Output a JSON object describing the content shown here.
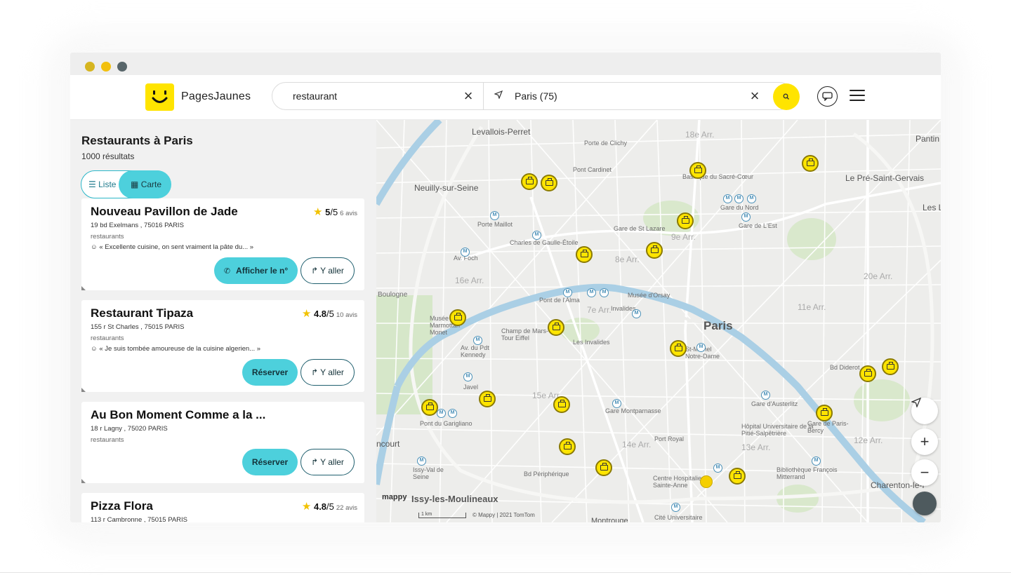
{
  "colors": {
    "brand_yellow": "#ffe400",
    "accent_teal": "#4dd0dc",
    "window_dot_1": "#d6b520",
    "window_dot_2": "#f2c00e",
    "window_dot_3": "#58666a"
  },
  "header": {
    "logo_text": "PagesJaunes",
    "search_query": "restaurant",
    "search_location": "Paris (75)"
  },
  "sidebar": {
    "title": "Restaurants à Paris",
    "count": "1000 résultats",
    "toggle_list": "Liste",
    "toggle_map": "Carte",
    "results": [
      {
        "name": "Nouveau Pavillon de Jade",
        "address": "19 bd Exelmans , 75016 PARIS",
        "category": "restaurants",
        "review": "« Excellente cuisine, on sent vraiment la pâte du... »",
        "rating": "5",
        "rating_max": "/5",
        "reviews_count": "6 avis",
        "primary_button": "Afficher le n°",
        "secondary_button": "Y aller"
      },
      {
        "name": "Restaurant Tipaza",
        "address": "155 r St Charles , 75015 PARIS",
        "category": "restaurants",
        "review": "« Je suis tombée amoureuse de la cuisine algerien... »",
        "rating": "4.8",
        "rating_max": "/5",
        "reviews_count": "10 avis",
        "primary_button": "Réserver",
        "secondary_button": "Y aller"
      },
      {
        "name": "Au Bon Moment Comme a la ...",
        "address": "18 r Lagny , 75020 PARIS",
        "category": "restaurants",
        "primary_button": "Réserver",
        "secondary_button": "Y aller"
      },
      {
        "name": "Pizza Flora",
        "address": "113 r Cambronne , 75015 PARIS",
        "rating": "4.8",
        "rating_max": "/5",
        "reviews_count": "22 avis"
      }
    ]
  },
  "map": {
    "city_label": "Paris",
    "labels": [
      "Levallois-Perret",
      "Neuilly-sur-Seine",
      "Pantin",
      "Le Pré-Saint-Gervais",
      "Les L",
      "Porte de Clichy",
      "Pont Cardinet",
      "Basilique du Sacré-Cœur",
      "Gare du Nord",
      "Gare de L'Est",
      "Porte Maillot",
      "Charles de Gaulle-Étoile",
      "Gare de St Lazare",
      "Av. Foch",
      "16e Arr.",
      "8e Arr.",
      "Pont de l'Alma",
      "Invalides",
      "Musée d'Orsay",
      "7e Arr.",
      "Musée Marmottan Monet",
      "Champ de Mars-Tour Eiffel",
      "Les Invalides",
      "Av. du Pdt Kennedy",
      "St-Michel Notre-Dame",
      "15e Arr.",
      "Gare Montparnasse",
      "Javel",
      "Pont du Garigliano",
      "Port Royal",
      "Gare d'Austerlitz",
      "Hôpital Universitaire de la Pitié-Salpêtrière",
      "Gare de Paris-Bercy",
      "14e Arr.",
      "13e Arr.",
      "Bibliothèque François Mitterrand",
      "Centre Hospitalier Sainte-Anne",
      "Cité Universitaire",
      "Issy-les-Moulineaux",
      "Charenton-le-P",
      "Bd Diderot",
      "20e Arr.",
      "Bd Périphérique",
      "9e Arr.",
      "18e Arr.",
      "11e Arr.",
      "12e Arr.",
      "Boulogne",
      "ncourt",
      "Issy-Val de Seine",
      "Montrouge"
    ],
    "brand": "mappy",
    "scale_label": "1 km",
    "copyright": "© Mappy | 2021 TomTom",
    "controls": {
      "locate": "locate-icon",
      "zoom_in": "+",
      "zoom_out": "−"
    }
  }
}
